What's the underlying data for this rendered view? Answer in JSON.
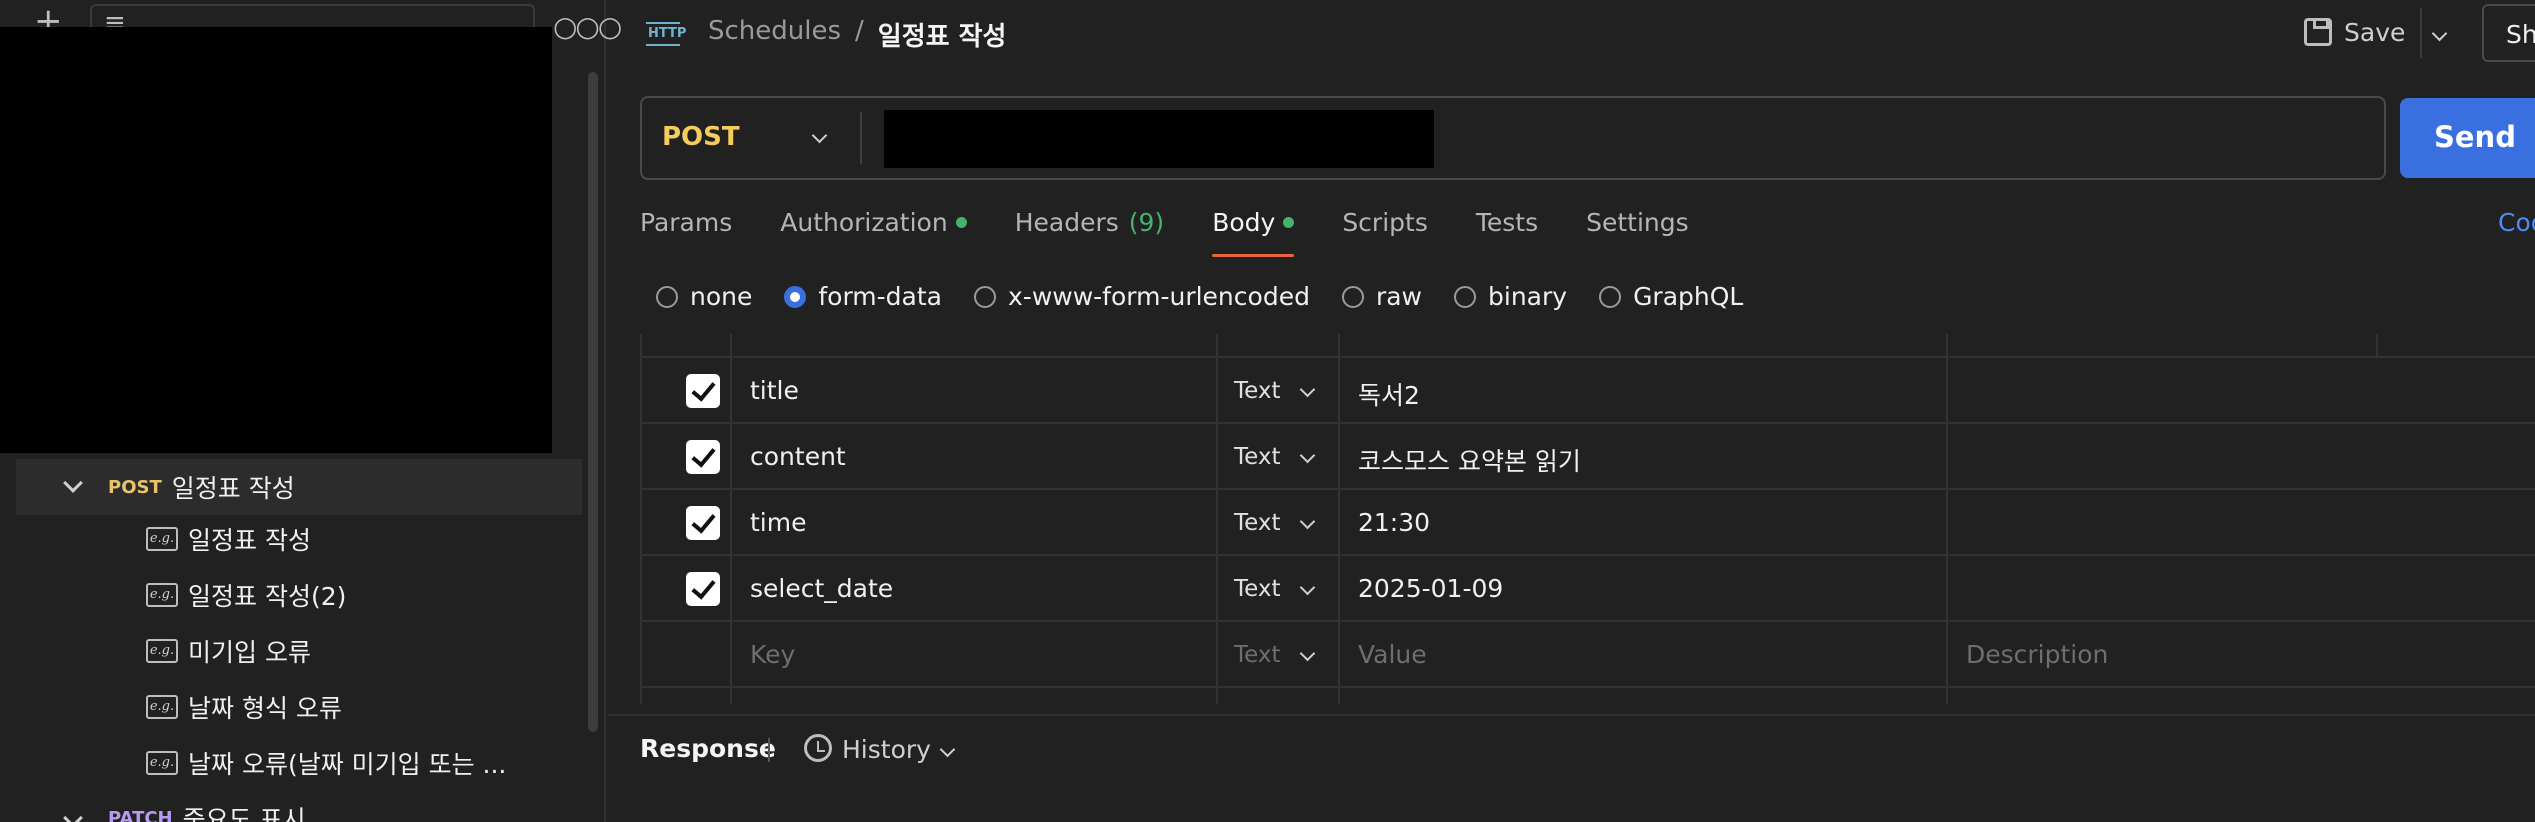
{
  "sidebar": {
    "selected_request": {
      "method": "POST",
      "label": "일정표 작성"
    },
    "examples": [
      {
        "label": "일정표 작성"
      },
      {
        "label": "일정표 작성(2)"
      },
      {
        "label": "미기입 오류"
      },
      {
        "label": "날짜 형식 오류"
      },
      {
        "label": "날짜 오류(날짜 미기입 또는 ..."
      }
    ],
    "next_request": {
      "method": "PATCH",
      "label": "중요도 표시"
    },
    "example_icon_text": "e.g."
  },
  "header": {
    "protocol_icon": "HTTP",
    "breadcrumb_parent": "Schedules",
    "breadcrumb_sep": "/",
    "breadcrumb_current": "일정표 작성",
    "save_label": "Save",
    "share_label": "Sh"
  },
  "request": {
    "method": "POST",
    "send_label": "Send"
  },
  "tabs": [
    {
      "label": "Params"
    },
    {
      "label": "Authorization",
      "dot": true
    },
    {
      "label": "Headers",
      "count": "(9)"
    },
    {
      "label": "Body",
      "dot": true,
      "active": true
    },
    {
      "label": "Scripts"
    },
    {
      "label": "Tests"
    },
    {
      "label": "Settings"
    }
  ],
  "code_link": "Coo",
  "body_types": [
    {
      "label": "none",
      "selected": false
    },
    {
      "label": "form-data",
      "selected": true
    },
    {
      "label": "x-www-form-urlencoded",
      "selected": false
    },
    {
      "label": "raw",
      "selected": false
    },
    {
      "label": "binary",
      "selected": false
    },
    {
      "label": "GraphQL",
      "selected": false
    }
  ],
  "form_rows": [
    {
      "checked": true,
      "key": "title",
      "type": "Text",
      "value": "독서2",
      "description": ""
    },
    {
      "checked": true,
      "key": "content",
      "type": "Text",
      "value": "코스모스 요약본 읽기",
      "description": ""
    },
    {
      "checked": true,
      "key": "time",
      "type": "Text",
      "value": "21:30",
      "description": ""
    },
    {
      "checked": true,
      "key": "select_date",
      "type": "Text",
      "value": "2025-01-09",
      "description": ""
    }
  ],
  "form_placeholder": {
    "key": "Key",
    "type": "Text",
    "value": "Value",
    "description": "Description"
  },
  "response": {
    "label": "Response",
    "history_label": "History"
  },
  "colors": {
    "accent_blue": "#3a6fe0",
    "post_yellow": "#f5cd5c",
    "status_green": "#45b36b",
    "active_tab_underline": "#e8643c"
  }
}
